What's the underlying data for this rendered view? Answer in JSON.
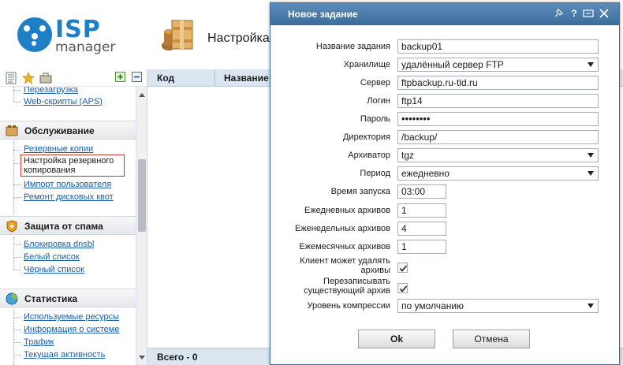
{
  "header": {
    "logo_isp": "ISP",
    "logo_manager": "manager",
    "title": "Настройка"
  },
  "sidebar": {
    "toolbar": {
      "icons": [
        "list-icon",
        "star-icon",
        "briefcase-icon",
        "expand-all-icon",
        "collapse-all-icon"
      ]
    },
    "top_items": [
      {
        "label": "Перезагрузка"
      },
      {
        "label": "Web-скрипты (APS)"
      }
    ],
    "sections": [
      {
        "title": "Обслуживание",
        "icon": "maintenance-icon",
        "items": [
          {
            "label": "Резервные копии"
          },
          {
            "label": "Настройка резервного копирования",
            "selected": true
          },
          {
            "label": "Импорт пользователя"
          },
          {
            "label": "Ремонт дисковых квот"
          }
        ]
      },
      {
        "title": "Защита от спама",
        "icon": "spam-shield-icon",
        "items": [
          {
            "label": "Блокировка dnsbl"
          },
          {
            "label": "Белый список"
          },
          {
            "label": "Чёрный список"
          }
        ]
      },
      {
        "title": "Статистика",
        "icon": "statistics-icon",
        "items": [
          {
            "label": "Используемые ресурсы"
          },
          {
            "label": "Информация о системе"
          },
          {
            "label": "Трафик"
          },
          {
            "label": "Текущая активность"
          }
        ]
      }
    ]
  },
  "grid": {
    "columns": [
      "Код",
      "Название"
    ],
    "footer": "Всего - 0"
  },
  "dialog": {
    "title": "Новое задание",
    "controls": [
      "pin-icon",
      "help-icon",
      "resize-icon",
      "close-icon"
    ],
    "fields": {
      "name": {
        "label": "Название задания",
        "value": "backup01"
      },
      "storage": {
        "label": "Хранилище",
        "value": "удалённый сервер FTP"
      },
      "server": {
        "label": "Сервер",
        "value": "ftpbackup.ru-tld.ru"
      },
      "login": {
        "label": "Логин",
        "value": "ftp14"
      },
      "password": {
        "label": "Пароль",
        "value": "••••••••"
      },
      "directory": {
        "label": "Директория",
        "value": "/backup/"
      },
      "archiver": {
        "label": "Архиватор",
        "value": "tgz"
      },
      "period": {
        "label": "Период",
        "value": "ежедневно"
      },
      "start_time": {
        "label": "Время запуска",
        "value": "03:00"
      },
      "daily": {
        "label": "Ежедневных архивов",
        "value": "1"
      },
      "weekly": {
        "label": "Еженедельных архивов",
        "value": "4"
      },
      "monthly": {
        "label": "Ежемесячных архивов",
        "value": "1"
      },
      "client_delete": {
        "label_line1": "Клиент может удалять",
        "label_line2": "архивы",
        "checked": true
      },
      "overwrite": {
        "label_line1": "Перезаписывать",
        "label_line2": "существующий архив",
        "checked": true
      },
      "compression": {
        "label": "Уровень компрессии",
        "value": "по умолчанию"
      }
    },
    "ok_label": "Ok",
    "cancel_label": "Отмена"
  },
  "colors": {
    "brand": "#1e7fc6",
    "link": "#1a5fa8",
    "dialog_title": "#3c6c9a",
    "grid_header": "#dbe6f0",
    "selected_border": "#c0392b"
  }
}
